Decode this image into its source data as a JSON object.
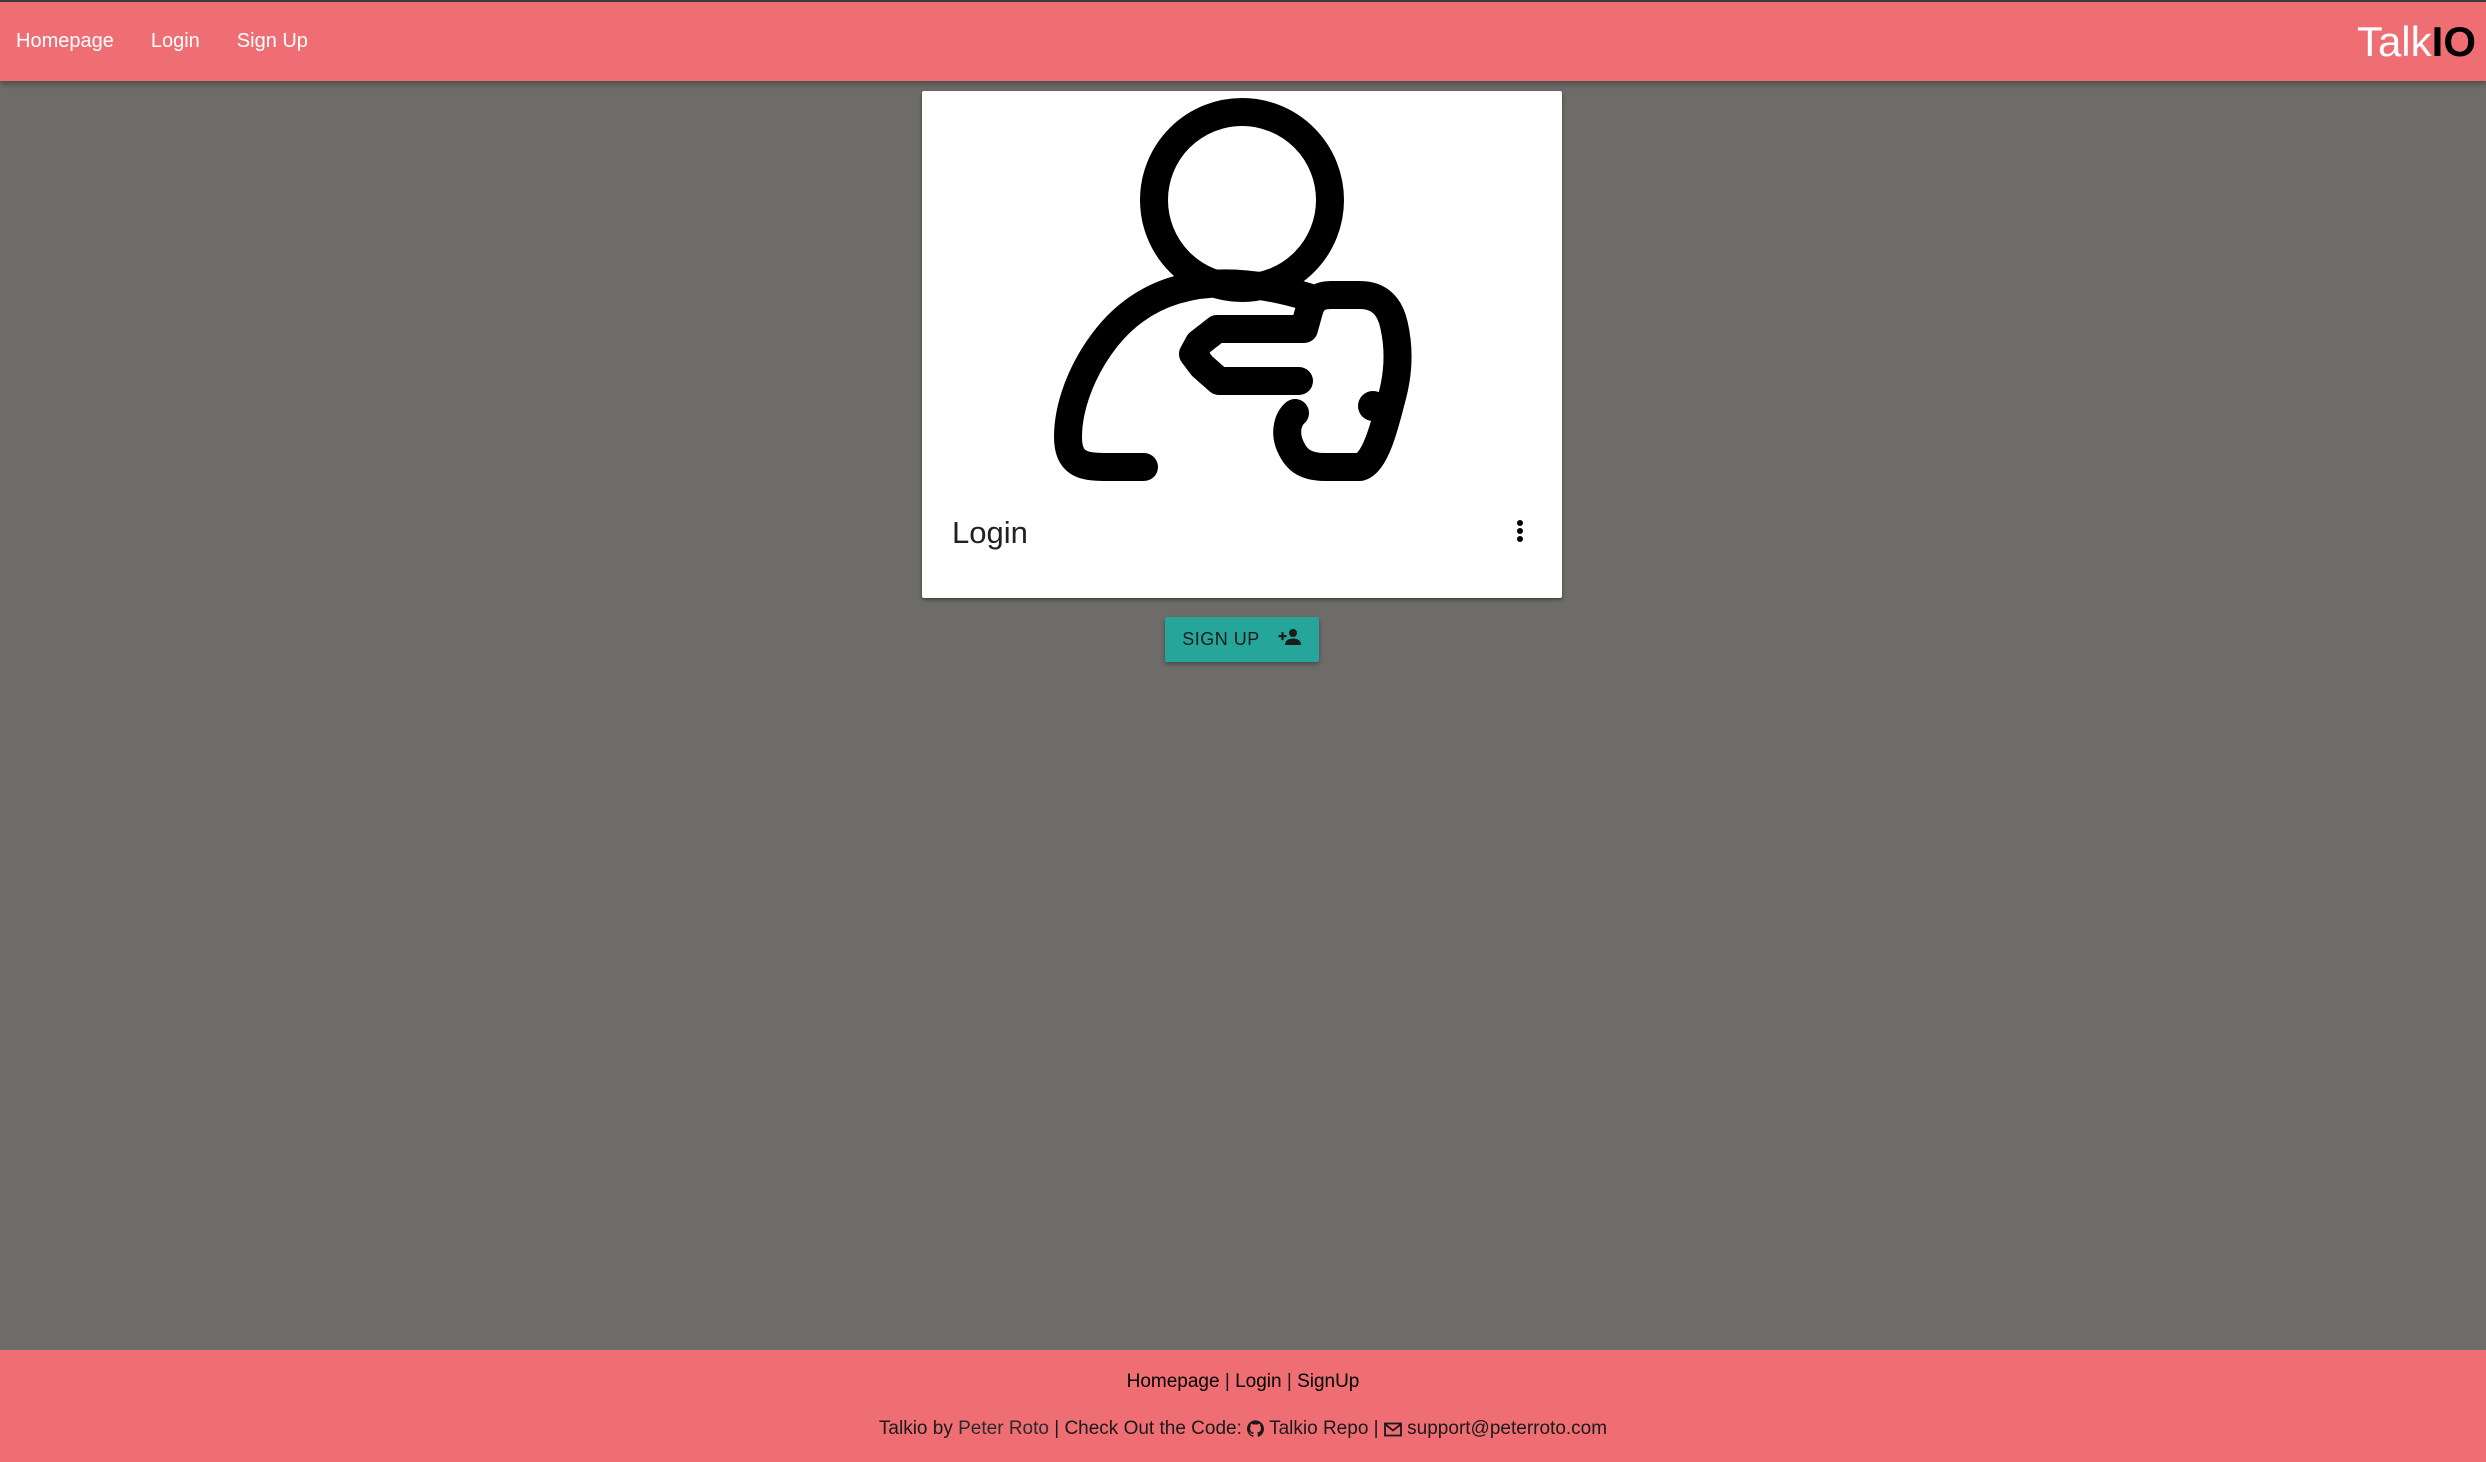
{
  "navbar": {
    "links": [
      "Homepage",
      "Login",
      "Sign Up"
    ],
    "brand_main": "Talk",
    "brand_accent": "IO",
    "background_color": "#ef6e73"
  },
  "card": {
    "image_icon": "user-key-icon",
    "title": "Login",
    "menu_icon": "more-vert-icon"
  },
  "signup_button": {
    "label": "SIGN UP",
    "icon": "person-add-icon",
    "color": "#26a69a"
  },
  "footer": {
    "links": [
      "Homepage",
      "Login",
      "SignUp"
    ],
    "separator": "|",
    "credit_prefix": "Talkio by",
    "author": "Peter Roto",
    "code_text": "Check Out the Code:",
    "repo_icon": "github-icon",
    "repo_label": "Talkio Repo",
    "email_icon": "envelope-icon",
    "email": "support@peterroto.com"
  }
}
